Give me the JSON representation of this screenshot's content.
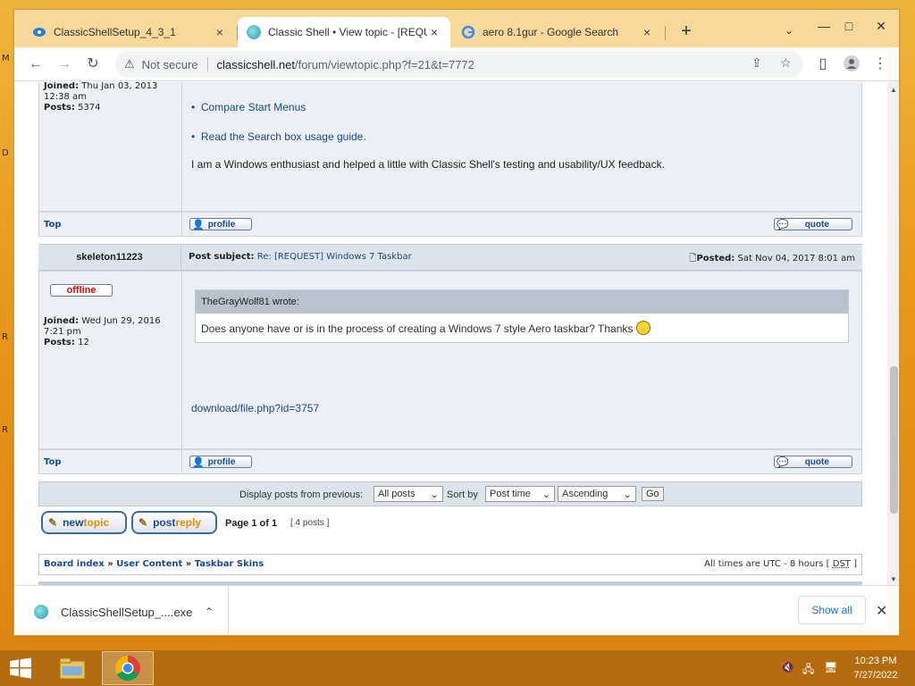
{
  "desktop": {
    "edge_letters": [
      "M",
      "D",
      "R",
      "R"
    ]
  },
  "tabs": [
    {
      "title": "ClassicShellSetup_4_3_1",
      "close": "×"
    },
    {
      "title": "Classic Shell • View topic - [REQU",
      "close": "×"
    },
    {
      "title": "aero 8.1gur - Google Search",
      "close": "×"
    }
  ],
  "browser": {
    "new_tab": "+",
    "tab_menu": "⌄",
    "window": {
      "minimize": "—",
      "maximize": "□",
      "close": "✕"
    },
    "nav": {
      "back": "←",
      "forward": "→",
      "reload": "↻"
    },
    "omnibox": {
      "warning": "⚠",
      "security": "Not secure",
      "host": "classicshell.net",
      "path": "/forum/viewtopic.php?f=21&t=7772"
    },
    "actions": {
      "share": "⇪",
      "bookmark": "☆",
      "sidebar": "▯",
      "menu": "⋮"
    }
  },
  "post1": {
    "joined_label": "Joined:",
    "joined_value": "Thu Jan 03, 2013",
    "joined_time": "12:38 am",
    "posts_label": "Posts:",
    "posts_value": "5374",
    "links": [
      "Compare Start Menus",
      "Read the Search box usage guide."
    ],
    "text": "I am a Windows enthusiast and helped a little with Classic Shell's testing and usability/UX feedback."
  },
  "post_actions": {
    "top": "Top",
    "profile": "profile",
    "quote": "quote"
  },
  "post2": {
    "author": "skeleton11223",
    "subject_label": "Post subject:",
    "subject": "Re: [REQUEST] Windows 7 Taskbar",
    "posted_label": "Posted:",
    "posted_value": "Sat Nov 04, 2017 8:01 am",
    "status": "offline",
    "joined_label": "Joined:",
    "joined_value": "Wed Jun 29, 2016",
    "joined_time": "7:21 pm",
    "posts_label": "Posts:",
    "posts_value": "12",
    "quote_author": "TheGrayWolf81 wrote:",
    "quote_text": "Does anyone have or is in the process of creating a Windows 7 style Aero taskbar? Thanks",
    "attachment": "download/file.php?id=3757"
  },
  "display_controls": {
    "label": "Display posts from previous:",
    "filter": "All posts",
    "sort_label": "Sort by",
    "sort": "Post time",
    "order": "Ascending",
    "go": "Go"
  },
  "pagination": {
    "newtopic": [
      "new",
      "topic"
    ],
    "postreply": [
      "post",
      "reply"
    ],
    "page": "Page 1 of 1",
    "posts": "[ 4 posts ]"
  },
  "breadcrumb": {
    "items": [
      "Board index",
      "User Content",
      "Taskbar Skins"
    ],
    "sep": "»",
    "timezone": "All times are UTC - 8 hours [",
    "dst": "DST",
    "tz_close": "]"
  },
  "downloads": {
    "file": "ClassicShellSetup_....exe",
    "chevron": "⌃",
    "show_all": "Show all",
    "close": "✕"
  },
  "taskbar": {
    "tray": [
      "🔇",
      "🖧",
      "🖥"
    ],
    "time": "10:23 PM",
    "date": "7/27/2022"
  }
}
